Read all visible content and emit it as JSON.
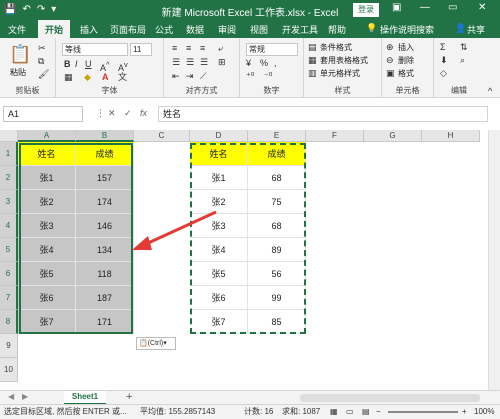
{
  "window": {
    "title": "新建 Microsoft Excel 工作表.xlsx - Excel",
    "login_label": "登录",
    "minimize": "—",
    "restore": "▭",
    "close": "✕"
  },
  "tabs": [
    "文件",
    "开始",
    "插入",
    "页面布局",
    "公式",
    "数据",
    "审阅",
    "视图",
    "开发工具",
    "帮助"
  ],
  "active_tab": "开始",
  "tell_me": "操作说明搜索",
  "share_label": "共享",
  "ribbon": {
    "clipboard": {
      "paste": "粘贴",
      "label": "剪贴板"
    },
    "font": {
      "name": "等线",
      "size": "11",
      "label": "字体"
    },
    "alignment": {
      "label": "对齐方式"
    },
    "number": {
      "format": "常规",
      "label": "数字"
    },
    "styles": {
      "conditional": "条件格式",
      "table": "套用表格格式",
      "cell_styles": "单元格样式",
      "label": "样式"
    },
    "cells": {
      "insert": "插入",
      "delete": "删除",
      "format": "格式",
      "label": "单元格"
    },
    "editing": {
      "label": "编辑"
    }
  },
  "formula_bar": {
    "name_box": "A1",
    "fx": "fx",
    "content": "姓名"
  },
  "columns": [
    "A",
    "B",
    "C",
    "D",
    "E",
    "F",
    "G",
    "H"
  ],
  "rows": [
    "1",
    "2",
    "3",
    "4",
    "5",
    "6",
    "7",
    "8",
    "9",
    "10"
  ],
  "left_table": {
    "headers": [
      "姓名",
      "成绩"
    ],
    "rows": [
      [
        "张1",
        "157"
      ],
      [
        "张2",
        "174"
      ],
      [
        "张3",
        "146"
      ],
      [
        "张4",
        "134"
      ],
      [
        "张5",
        "118"
      ],
      [
        "张6",
        "187"
      ],
      [
        "张7",
        "171"
      ]
    ]
  },
  "right_table": {
    "headers": [
      "姓名",
      "成绩"
    ],
    "rows": [
      [
        "张1",
        "68"
      ],
      [
        "张2",
        "75"
      ],
      [
        "张3",
        "68"
      ],
      [
        "张4",
        "89"
      ],
      [
        "张5",
        "56"
      ],
      [
        "张6",
        "99"
      ],
      [
        "张7",
        "85"
      ]
    ]
  },
  "paste_options": "(Ctrl)",
  "sheet": {
    "name": "Sheet1",
    "add": "+"
  },
  "status": {
    "message": "选定目标区域, 然后按 ENTER 或...",
    "average": "平均值: 155.2857143",
    "count": "计数: 16",
    "sum": "求和: 1087",
    "zoom": "100%"
  },
  "colors": {
    "accent": "#217346",
    "header_fill": "#ffff00",
    "arrow": "#e53935"
  }
}
